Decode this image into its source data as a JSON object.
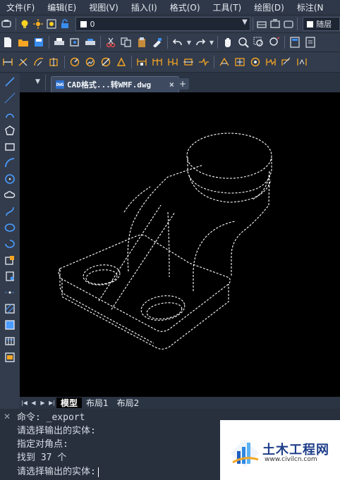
{
  "menu": [
    "文件(F)",
    "编辑(E)",
    "视图(V)",
    "插入(I)",
    "格式(O)",
    "工具(T)",
    "绘图(D)",
    "标注(N"
  ],
  "layer": {
    "current": "0",
    "color_label": "随层"
  },
  "tab": {
    "file": "CAD格式...转WMF.dwg",
    "icon_label": "DWG",
    "close": "×",
    "new": "+"
  },
  "layouts": {
    "model": "模型",
    "layout1": "布局1",
    "layout2": "布局2"
  },
  "command": {
    "history": [
      "命令: _export",
      "请选择输出的实体:",
      "指定对角点:",
      "找到 37 个"
    ],
    "prompt": "请选择输出的实体:"
  },
  "watermark": {
    "name": "土木工程网",
    "url": "www.civilcn.com"
  },
  "colors": {
    "accent": "#4a9cff",
    "canvas": "#000000",
    "ui": "#333c4c",
    "selection": "#ffffff"
  }
}
